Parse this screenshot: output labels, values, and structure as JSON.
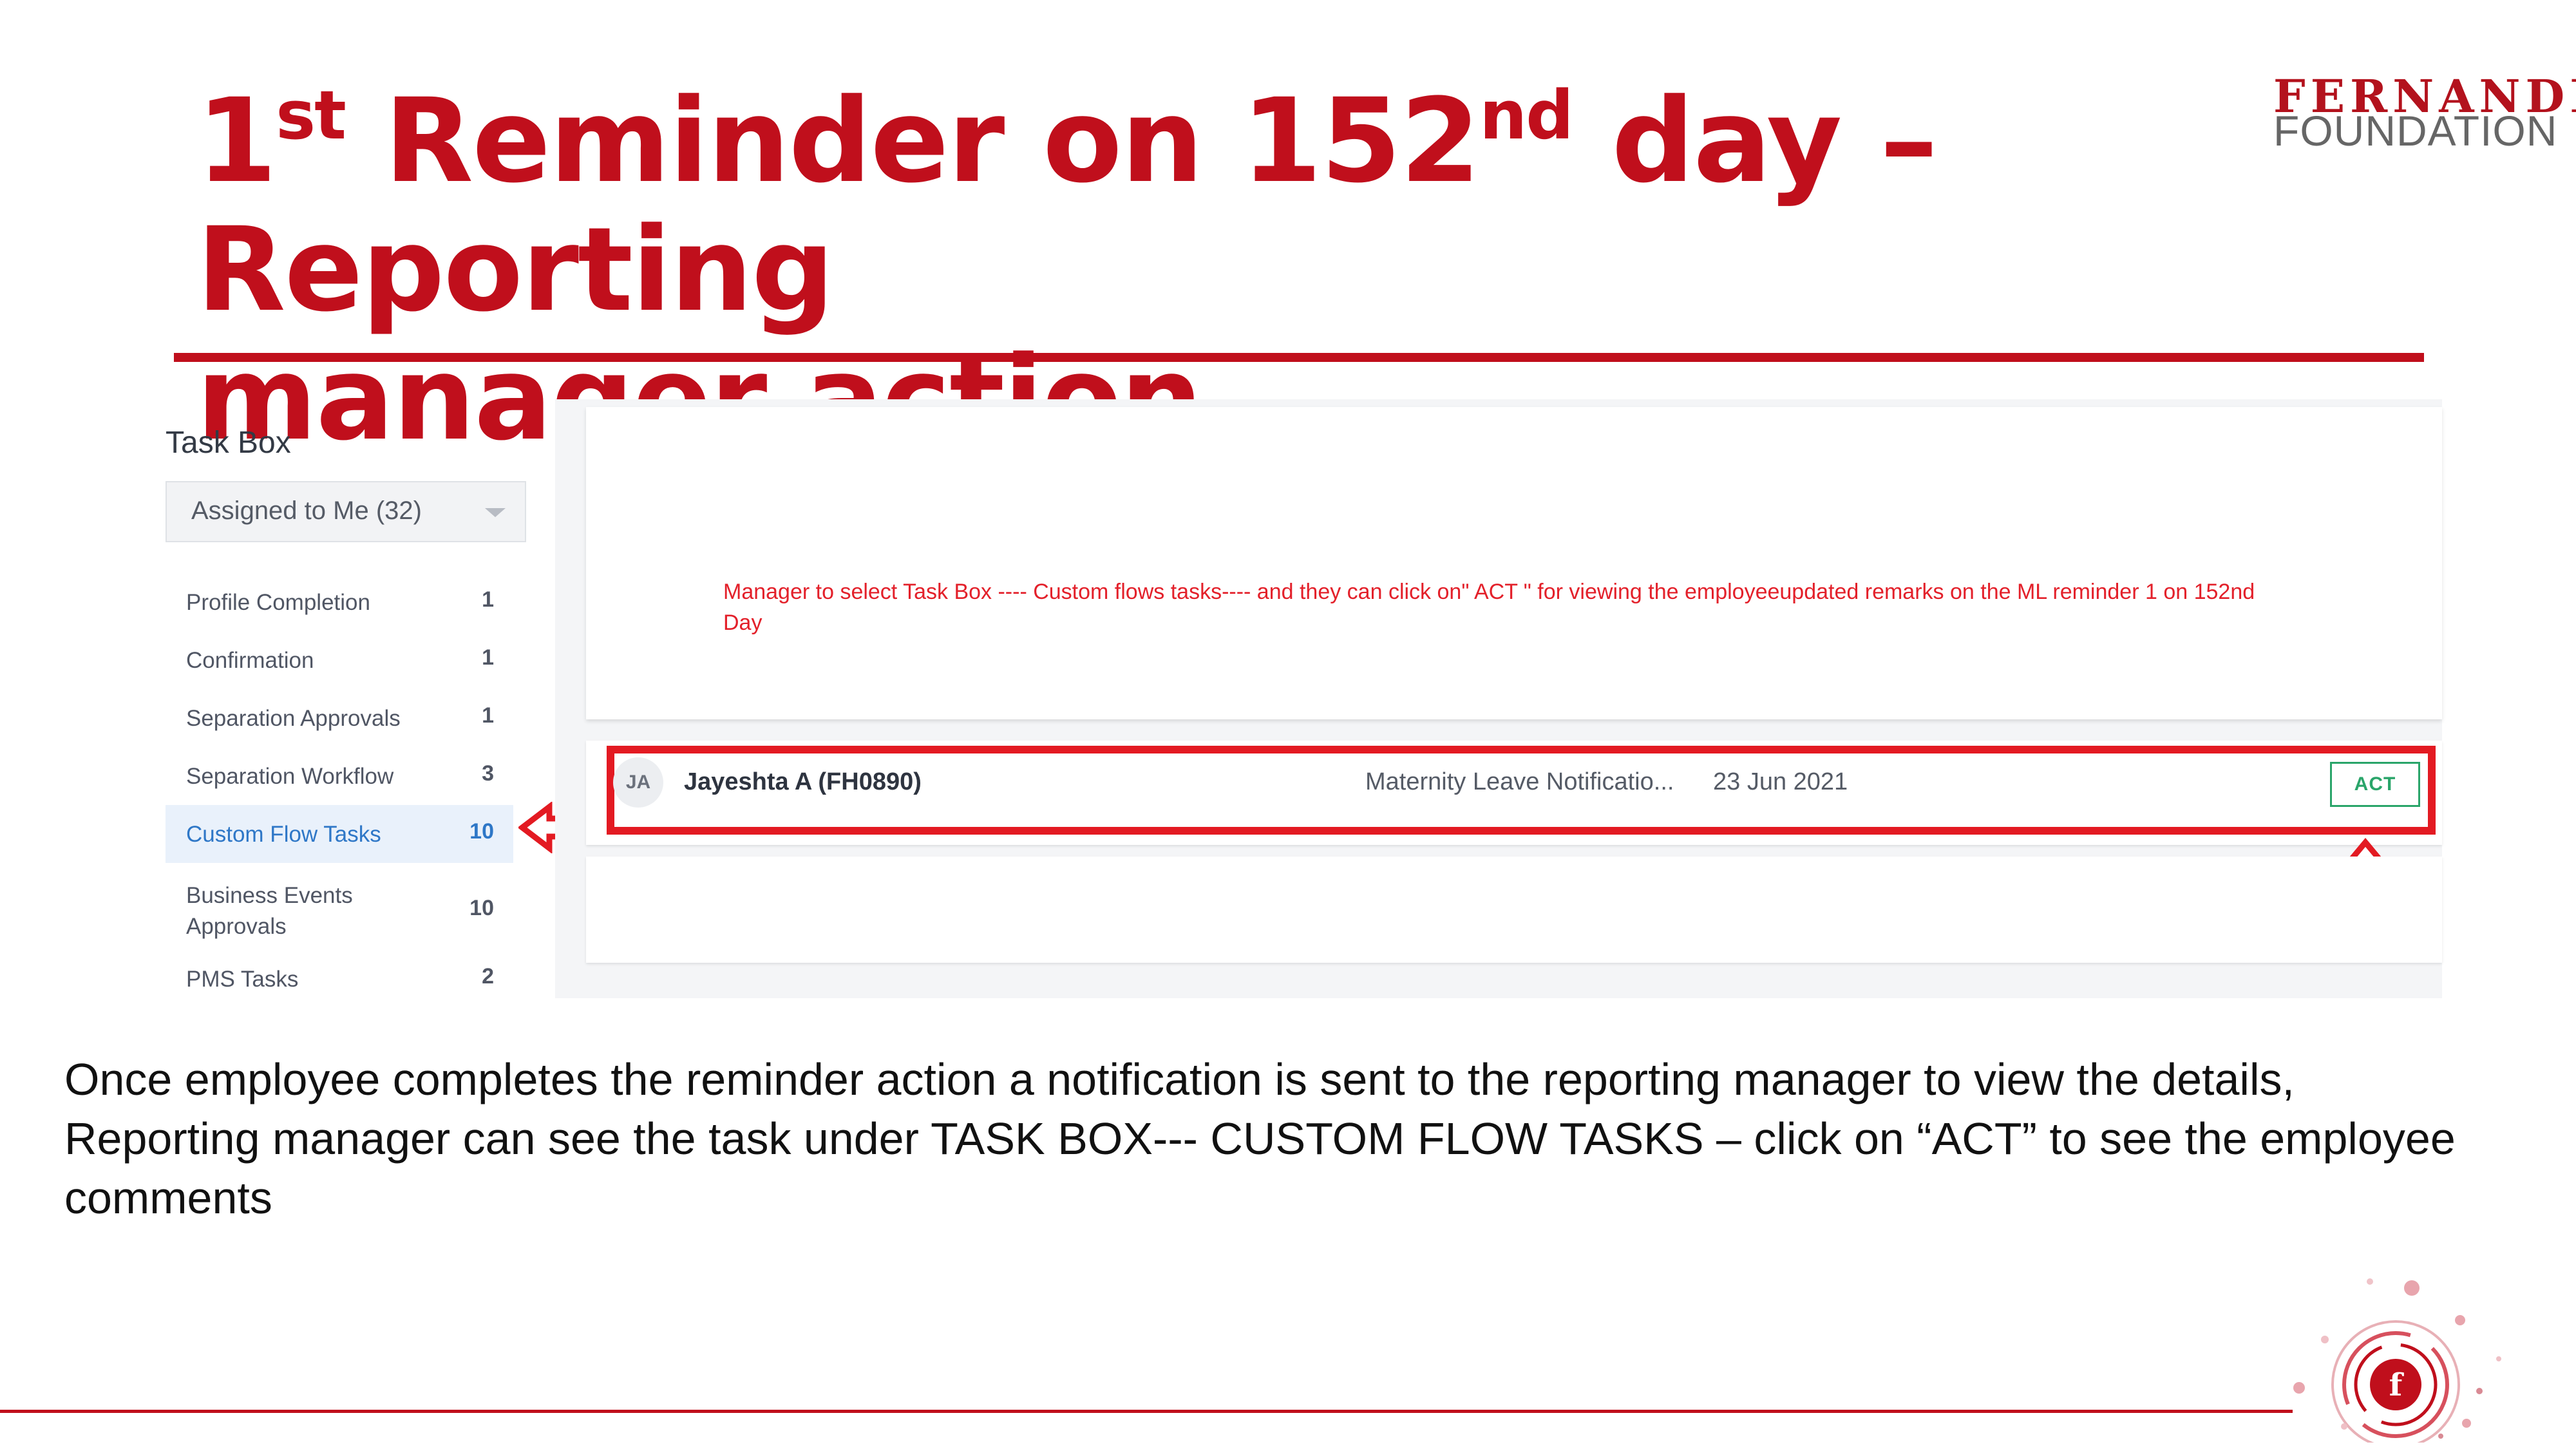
{
  "slide": {
    "title_prefix": "1",
    "title_sup1": "st",
    "title_mid": " Reminder on 152",
    "title_sup2": "nd",
    "title_rest": " day – Reporting",
    "title_line2": "manager action"
  },
  "logo": {
    "line1": "FERNANDEZ",
    "line2": "FOUNDATION"
  },
  "taskbox": {
    "title": "Task Box",
    "filter_value": "Assigned to Me (32)",
    "items": [
      {
        "label": "Profile Completion",
        "count": "1"
      },
      {
        "label": "Confirmation",
        "count": "1"
      },
      {
        "label": "Separation Approvals",
        "count": "1"
      },
      {
        "label": "Separation Workflow",
        "count": "3"
      },
      {
        "label": "Custom Flow Tasks",
        "count": "10",
        "active": true
      },
      {
        "label": "Business Events Approvals",
        "count": "10"
      },
      {
        "label": "PMS Tasks",
        "count": "2"
      }
    ]
  },
  "annotation": "Manager to select Task Box ---- Custom flows tasks---- and they can click on\" ACT \" for viewing  the employeeupdated remarks on the ML reminder 1 on 152nd Day",
  "task_row": {
    "avatar_initials": "JA",
    "employee": "Jayeshta A (FH0890)",
    "type": "Maternity Leave Notificatio...",
    "date": "23 Jun 2021",
    "action": "ACT"
  },
  "caption": "Once employee completes the reminder action a notification is sent to the reporting manager to view the details, Reporting manager can see the task under TASK BOX--- CUSTOM FLOW TASKS – click on “ACT” to see the employee comments",
  "colors": {
    "brand_red": "#c00f1c",
    "annotation_red": "#e31a22",
    "active_blue": "#2e77c7",
    "act_green": "#2aa56a"
  },
  "icons": [
    "chevron-down-icon",
    "arrow-left-icon",
    "arrow-up-icon",
    "foundation-emblem-icon"
  ]
}
